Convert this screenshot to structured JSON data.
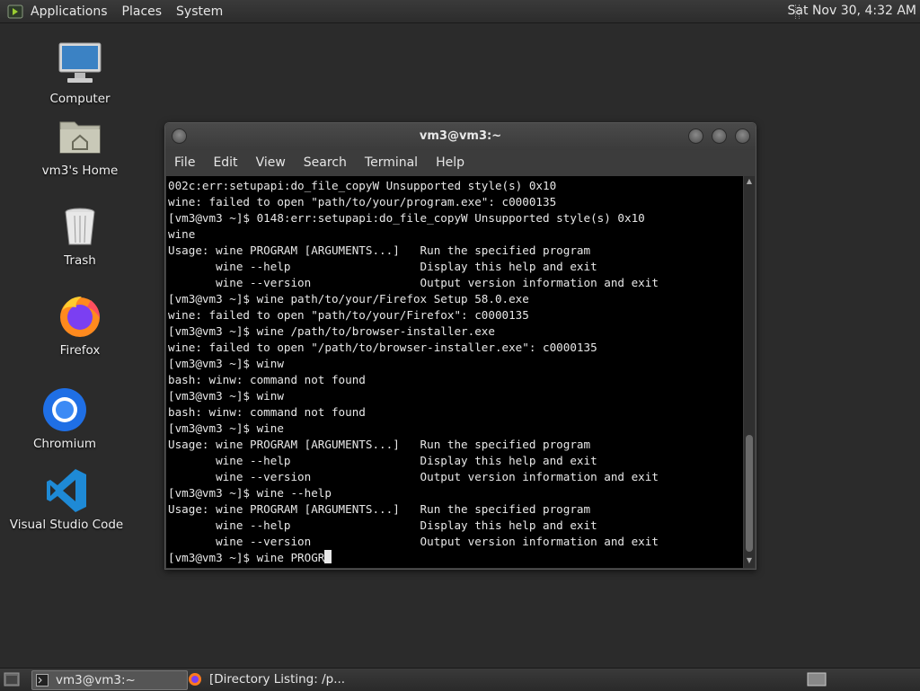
{
  "top_panel": {
    "menus": [
      "Applications",
      "Places",
      "System"
    ],
    "clock": "Sat Nov 30,  4:32 AM"
  },
  "desktop": {
    "icons": [
      {
        "label": "Computer",
        "icon": "computer-icon"
      },
      {
        "label": "vm3's Home",
        "icon": "home-folder-icon"
      },
      {
        "label": "Trash",
        "icon": "trash-icon"
      },
      {
        "label": "Firefox",
        "icon": "firefox-icon"
      },
      {
        "label": "Chromium",
        "icon": "chromium-icon"
      },
      {
        "label": "Visual Studio Code",
        "icon": "vscode-icon"
      }
    ]
  },
  "terminal": {
    "title": "vm3@vm3:~",
    "menus": [
      "File",
      "Edit",
      "View",
      "Search",
      "Terminal",
      "Help"
    ],
    "lines": [
      "002c:err:setupapi:do_file_copyW Unsupported style(s) 0x10",
      "wine: failed to open \"path/to/your/program.exe\": c0000135",
      "[vm3@vm3 ~]$ 0148:err:setupapi:do_file_copyW Unsupported style(s) 0x10",
      "wine",
      "Usage: wine PROGRAM [ARGUMENTS...]   Run the specified program",
      "       wine --help                   Display this help and exit",
      "       wine --version                Output version information and exit",
      "[vm3@vm3 ~]$ wine path/to/your/Firefox Setup 58.0.exe",
      "wine: failed to open \"path/to/your/Firefox\": c0000135",
      "[vm3@vm3 ~]$ wine /path/to/browser-installer.exe",
      "wine: failed to open \"/path/to/browser-installer.exe\": c0000135",
      "[vm3@vm3 ~]$ winw",
      "bash: winw: command not found",
      "[vm3@vm3 ~]$ winw",
      "bash: winw: command not found",
      "[vm3@vm3 ~]$ wine",
      "Usage: wine PROGRAM [ARGUMENTS...]   Run the specified program",
      "       wine --help                   Display this help and exit",
      "       wine --version                Output version information and exit",
      "[vm3@vm3 ~]$ wine --help",
      "Usage: wine PROGRAM [ARGUMENTS...]   Run the specified program",
      "       wine --help                   Display this help and exit",
      "       wine --version                Output version information and exit"
    ],
    "current_input": "[vm3@vm3 ~]$ wine PROGR"
  },
  "taskbar": {
    "items": [
      {
        "label": "vm3@vm3:~",
        "active": true
      },
      {
        "label": "[Directory Listing: /p...",
        "active": false
      }
    ]
  },
  "colors": {
    "desktop_bg": "#2b2b2b",
    "terminal_bg": "#000000",
    "terminal_fg": "#e8e8e8"
  }
}
